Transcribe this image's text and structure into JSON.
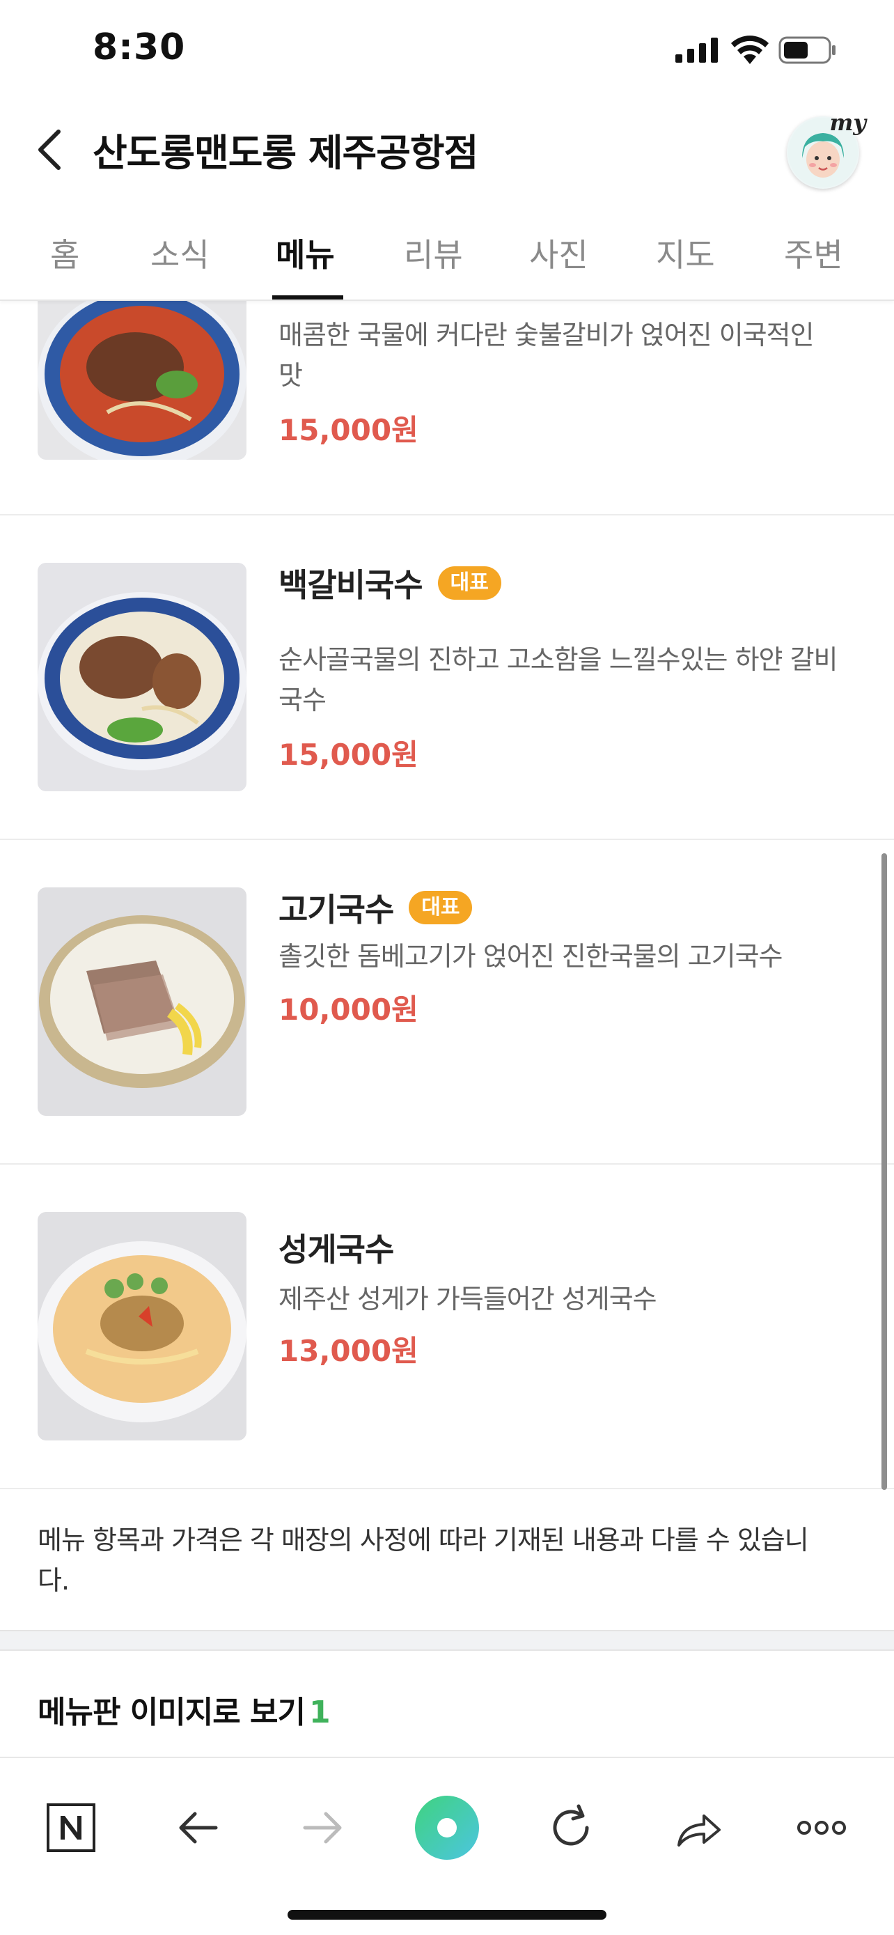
{
  "status": {
    "time": "8:30"
  },
  "header": {
    "title": "산도롱맨도롱 제주공항점",
    "avatar_label": "my"
  },
  "tabs": [
    {
      "label": "홈"
    },
    {
      "label": "소식"
    },
    {
      "label": "메뉴",
      "active": true
    },
    {
      "label": "리뷰"
    },
    {
      "label": "사진"
    },
    {
      "label": "지도"
    },
    {
      "label": "주변"
    }
  ],
  "menu": {
    "items": [
      {
        "name": "",
        "badge": "",
        "desc_lines": [
          "매콤한 국물에 커다란 숯불갈비가 얹어진 이국적인",
          "맛"
        ],
        "price": "15,000원"
      },
      {
        "name": "백갈비국수",
        "badge": "대표",
        "desc_lines": [
          "순사골국물의 진하고 고소함을 느낄수있는 하얀 갈비",
          "국수"
        ],
        "price": "15,000원"
      },
      {
        "name": "고기국수",
        "badge": "대표",
        "desc_lines": [
          "촐깃한 돔베고기가 얹어진 진한국물의 고기국수"
        ],
        "price": "10,000원"
      },
      {
        "name": "성게국수",
        "badge": "",
        "desc_lines": [
          "제주산 성게가 가득들어간 성게국수"
        ],
        "price": "13,000원"
      }
    ]
  },
  "notice": {
    "lines": [
      "메뉴 항목과 가격은 각 매장의 사정에 따라 기재된 내용과 다를 수 있습니",
      "다."
    ]
  },
  "menuboard": {
    "label": "메뉴판 이미지로 보기",
    "count": "1"
  },
  "bottom_bar": {
    "buttons": [
      "naver-home",
      "back",
      "forward",
      "green-dot",
      "reload",
      "share",
      "more"
    ]
  },
  "colors": {
    "price": "#e05a4e",
    "badge": "#f5a623",
    "count": "#3fb25b",
    "green_dot": "#47d493"
  }
}
